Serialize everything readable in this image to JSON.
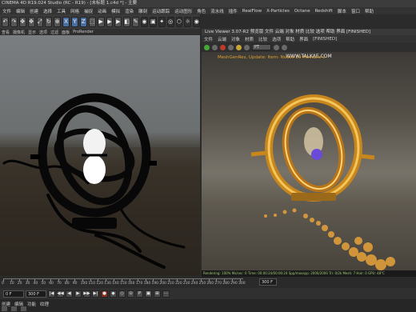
{
  "window": {
    "title": "CINEMA 4D R19.024 Studio (RC - R19) - [未标题 1.c4d *] - 主要"
  },
  "menubar": [
    "文件",
    "编辑",
    "创建",
    "选择",
    "工具",
    "网格",
    "捕捉",
    "动画",
    "模拟",
    "渲染",
    "雕刻",
    "运动跟踪",
    "运动图形",
    "角色",
    "流水线",
    "插件",
    "RealFlow",
    "X-Particles",
    "Octane",
    "Redshift",
    "脚本",
    "窗口",
    "帮助"
  ],
  "toolbar": {
    "buttons": [
      "↶",
      "↷",
      "✥",
      "✥",
      "⤢",
      "↻",
      "⊕",
      "X",
      "Y",
      "Z",
      "⬚",
      "▶",
      "▶",
      "▶",
      "◧",
      "✎",
      "◉",
      "▣",
      "✦",
      "◎",
      "⬡",
      "☼",
      "◉"
    ]
  },
  "viewport": {
    "menu": [
      "查看",
      "摄像机",
      "显示",
      "选项",
      "过滤",
      "面板",
      "ProRender"
    ]
  },
  "live_viewer": {
    "title": "Live Viewer 3.07-R2 预览版 文件 云端 对象 材质 比较 选项 帮助 界面 [FINISHED]",
    "menu": [
      "文件",
      "云端",
      "对象",
      "材质",
      "比较",
      "选项",
      "帮助",
      "界面"
    ],
    "status_word": "[FINISHED]",
    "watermark": "WWW.TALKAE.COM",
    "overlay": "MeshGenRes, Update: Item: Nodes 29 Movable 0",
    "mode": "PT",
    "stats": "Rendering: 100%  Ms/sec: 0  Time: 00:00:24/00:00:24  Spp/maxspp: 2000/2000  Tri: 0/2k  Mesh: 7  Hair: 0  GPU: 48°C"
  },
  "timeline": {
    "ticks": [
      "0",
      "10",
      "20",
      "30",
      "40",
      "50",
      "60",
      "70",
      "80",
      "90",
      "100",
      "110",
      "120",
      "130",
      "140",
      "150",
      "160",
      "170",
      "180",
      "190",
      "200",
      "210",
      "220",
      "230",
      "240",
      "250",
      "260",
      "270",
      "280",
      "290",
      "300"
    ],
    "end_frame": "300 F"
  },
  "transport": {
    "start_field": "0 F",
    "end_field": "300 F",
    "buttons": [
      "|◀",
      "◀◀",
      "◀",
      "▶",
      "▶▶",
      "▶|",
      "●",
      "◆",
      "◇",
      "⊙",
      "P",
      "▣",
      "⊞",
      "⋯"
    ]
  },
  "bottom_tabs": [
    "创建",
    "编辑",
    "功能",
    "纹理"
  ],
  "colors": {
    "accent_gold": "#e0a030",
    "live_green": "#47a83a",
    "record_red": "#c03a2a"
  }
}
